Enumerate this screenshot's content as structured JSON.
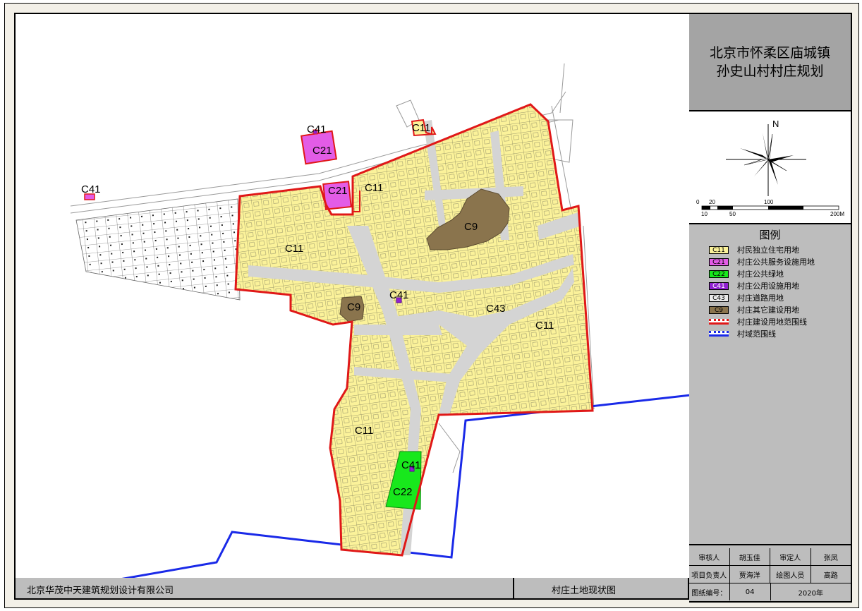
{
  "title": {
    "line1": "北京市怀柔区庙城镇",
    "line2": "孙史山村村庄规划"
  },
  "compass": {
    "north": "N",
    "scale_top": [
      "0",
      "20",
      "100"
    ],
    "scale_bottom": [
      "10",
      "50",
      "200M"
    ]
  },
  "legend": {
    "heading": "图例",
    "items": [
      {
        "code": "C11",
        "label": "村民独立住宅用地",
        "color": "#fbf29a"
      },
      {
        "code": "C21",
        "label": "村庄公共服务设施用地",
        "color": "#e35ce6"
      },
      {
        "code": "C22",
        "label": "村庄公共绿地",
        "color": "#18e81c"
      },
      {
        "code": "C41",
        "label": "村庄公用设施用地",
        "color": "#9020d0"
      },
      {
        "code": "C43",
        "label": "村庄道路用地",
        "color": "#eaeaea"
      },
      {
        "code": "C9",
        "label": "村庄其它建设用地",
        "color": "#8a744d"
      },
      {
        "code": "",
        "label": "村庄建设用地范围线",
        "color": "#e01818"
      },
      {
        "code": "",
        "label": "村域范围线",
        "color": "#1a2ae8"
      }
    ]
  },
  "signatures": {
    "row1": [
      "审核人",
      "胡玉佳",
      "审定人",
      "张凤"
    ],
    "row2": [
      "项目负责人",
      "贾海洋",
      "绘图人员",
      "高路"
    ],
    "row3": [
      "图纸编号：",
      "04",
      "2020年"
    ]
  },
  "footer": {
    "company": "北京华茂中天建筑规划设计有限公司",
    "plan_name": "村庄土地现状图"
  },
  "map_labels": {
    "c41_a": "C41",
    "c21_a": "C21",
    "c11_a": "C11",
    "c41_b": "C41",
    "c21_b": "C21",
    "c11_b": "C11",
    "c9_a": "C9",
    "c11_c": "C11",
    "c9_b": "C9",
    "c41_c": "C41",
    "c43": "C43",
    "c11_d": "C11",
    "c11_e": "C11",
    "c41_d": "C41",
    "c22": "C22"
  }
}
